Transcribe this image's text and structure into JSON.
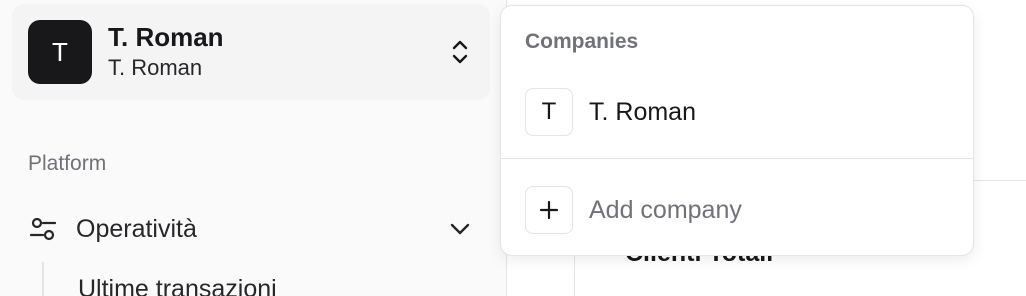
{
  "sidebar": {
    "company": {
      "avatar_letter": "T",
      "name": "T. Roman",
      "subtitle": "T. Roman"
    },
    "section_label": "Platform",
    "nav": {
      "label": "Operatività",
      "sub_items": [
        "Ultime transazioni"
      ]
    }
  },
  "main": {
    "card_title": "Clienti Totali"
  },
  "dropdown": {
    "heading": "Companies",
    "companies": [
      {
        "letter": "T",
        "name": "T. Roman"
      }
    ],
    "add_icon": "+",
    "add_label": "Add company"
  },
  "colors": {
    "accent": "#18181b",
    "muted": "#71717a",
    "border": "#e4e4e7",
    "sidebar_bg": "#fafafa"
  },
  "icons": {
    "switcher": "chevrons-up-down-icon",
    "nav": "sliders-icon",
    "nav_toggle": "chevron-down-icon",
    "add": "plus-icon"
  }
}
